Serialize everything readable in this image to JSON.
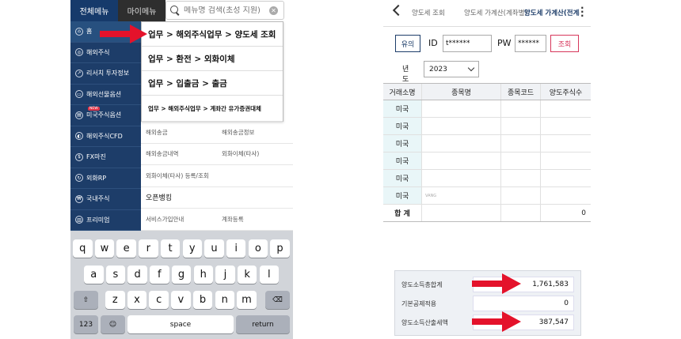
{
  "left": {
    "tabs": {
      "all_menu": "전체메뉴",
      "my_menu": "마이메뉴"
    },
    "search": {
      "placeholder": "메뉴명 검색(초성 지원)"
    },
    "sidebar": [
      {
        "label": "홈",
        "icon": "home-icon"
      },
      {
        "label": "해외주식",
        "icon": "globe-icon"
      },
      {
        "label": "리서치 투자정보",
        "icon": "chart-icon"
      },
      {
        "label": "해외선물옵션",
        "icon": "monitor-icon"
      },
      {
        "label": "미국주식옵션",
        "icon": "document-icon",
        "badge": "NEW"
      },
      {
        "label": "해외주식CFD",
        "icon": "cfd-icon"
      },
      {
        "label": "FX마진",
        "icon": "dollar-icon"
      },
      {
        "label": "외화RP",
        "icon": "rp-icon"
      },
      {
        "label": "국내주식",
        "icon": "won-icon"
      },
      {
        "label": "프리미엄",
        "icon": "premium-icon"
      }
    ],
    "search_results": [
      "업무 > 해외주식업무 > 양도세 조회",
      "업무 > 환전 > 외화이체",
      "업무 > 입출금 > 출금",
      "업무 > 해외주식업무 > 계좌간 유가증권대체"
    ],
    "menu_grid": [
      [
        "해외송금",
        "해외송금정보"
      ],
      [
        "해외송금내역",
        "외화이체(타사)"
      ],
      [
        "외화이체(타사) 등록/조회",
        ""
      ],
      [
        "오픈뱅킹"
      ],
      [
        "서비스가입안내",
        "계좌등록"
      ]
    ],
    "keyboard": {
      "row1": [
        "q",
        "w",
        "e",
        "r",
        "t",
        "y",
        "u",
        "i",
        "o",
        "p"
      ],
      "row2": [
        "a",
        "s",
        "d",
        "f",
        "g",
        "h",
        "j",
        "k",
        "l"
      ],
      "row3": [
        "z",
        "x",
        "c",
        "v",
        "b",
        "n",
        "m"
      ],
      "num_key": "123",
      "space_key": "space",
      "return_key": "return"
    }
  },
  "right": {
    "tabs": [
      "양도세 조회",
      "양도세 가계산(계좌별)",
      "양도세 가계산(전계좌)"
    ],
    "active_tab": "양도세 가계산(전계좌)",
    "form": {
      "type_button": "유의",
      "id_label": "ID",
      "id_value": "t******",
      "pw_label": "PW",
      "pw_value": "******",
      "query_button": "조회",
      "year_label": "년도",
      "year_value": "2023"
    },
    "table": {
      "headers": [
        "거래소명",
        "종목명",
        "종목코드",
        "양도주식수"
      ],
      "rows": [
        [
          "미국",
          "",
          "",
          ""
        ],
        [
          "미국",
          "",
          "",
          ""
        ],
        [
          "미국",
          "",
          "",
          ""
        ],
        [
          "미국",
          "",
          "",
          ""
        ],
        [
          "미국",
          "",
          "",
          ""
        ],
        [
          "미국",
          "VANG",
          "",
          ""
        ]
      ],
      "total": {
        "label": "합 계",
        "value": "0"
      }
    },
    "summary": [
      {
        "label": "양도소득총합계",
        "value": "1,761,583"
      },
      {
        "label": "기본공제적용",
        "value": "0"
      },
      {
        "label": "양도소득산출세액",
        "value": "387,547"
      }
    ]
  },
  "colors": {
    "navy": "#1d3d69",
    "arrow_red": "#e4122b",
    "query_pink": "#d7375b"
  }
}
